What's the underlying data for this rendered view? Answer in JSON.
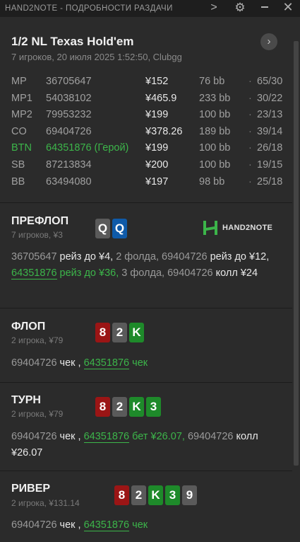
{
  "window": {
    "title": "HAND2NOTE - ПОДРОБНОСТИ РАЗДАЧИ",
    "chevron_glyph": ">",
    "gear_glyph": "⚙",
    "close_glyph": "✕"
  },
  "hand": {
    "title": "1/2 NL Texas Hold'em",
    "subtitle": "7 игроков, 20 июля 2025 1:52:50, Clubgg",
    "next_glyph": "›"
  },
  "players": [
    {
      "pos": "MP",
      "id": "36705647",
      "money": "¥152",
      "bb": "76 bb",
      "dot": "·",
      "stat": "65/30",
      "hero": false
    },
    {
      "pos": "MP1",
      "id": "54038102",
      "money": "¥465.9",
      "bb": "233 bb",
      "dot": "·",
      "stat": "30/22",
      "hero": false
    },
    {
      "pos": "MP2",
      "id": "79953232",
      "money": "¥199",
      "bb": "100 bb",
      "dot": "·",
      "stat": "23/13",
      "hero": false
    },
    {
      "pos": "CO",
      "id": "69404726",
      "money": "¥378.26",
      "bb": "189 bb",
      "dot": "·",
      "stat": "39/14",
      "hero": false
    },
    {
      "pos": "BTN",
      "id": "64351876 (Герой)",
      "money": "¥199",
      "bb": "100 bb",
      "dot": "·",
      "stat": "26/18",
      "hero": true
    },
    {
      "pos": "SB",
      "id": "87213834",
      "money": "¥200",
      "bb": "100 bb",
      "dot": "·",
      "stat": "19/15",
      "hero": false
    },
    {
      "pos": "BB",
      "id": "63494080",
      "money": "¥197",
      "bb": "98 bb",
      "dot": "·",
      "stat": "25/18",
      "hero": false
    }
  ],
  "logo_text": "HAND2NOTE",
  "colors": {
    "hero": "#3cb54a",
    "hearts": "#9b1515",
    "spades": "#5a5a5a",
    "clubs": "#1e8a2a",
    "diamonds": "#0f5aa8"
  },
  "streets": {
    "preflop": {
      "name": "ПРЕФЛОП",
      "sub": "7 игроков, ¥3",
      "cards": [
        {
          "rank": "Q",
          "suit": "spades"
        },
        {
          "rank": "Q",
          "suit": "diamonds"
        }
      ],
      "a1": "36705647 ",
      "a2": "рейз до ¥4,",
      "a3": " 2 фолда, 69404726 ",
      "a4": "рейз до ¥12,",
      "a5": " ",
      "a6": "64351876",
      "a7": " рейз до ¥36,",
      "a8": " 3 фолда, 69404726 ",
      "a9": "колл ¥24"
    },
    "flop": {
      "name": "ФЛОП",
      "sub": "2 игрока, ¥79",
      "cards": [
        {
          "rank": "8",
          "suit": "hearts"
        },
        {
          "rank": "2",
          "suit": "spades"
        },
        {
          "rank": "K",
          "suit": "clubs"
        }
      ],
      "a1": "69404726 ",
      "a2": "чек",
      ", ": "",
      "a3": " , ",
      "a4": "64351876",
      "a5": " чек"
    },
    "turn": {
      "name": "ТУРН",
      "sub": "2 игрока, ¥79",
      "cards": [
        {
          "rank": "8",
          "suit": "hearts"
        },
        {
          "rank": "2",
          "suit": "spades"
        },
        {
          "rank": "K",
          "suit": "clubs"
        },
        {
          "rank": "3",
          "suit": "clubs"
        }
      ],
      "a1": "69404726 ",
      "a2": "чек",
      "a3": " , ",
      "a4": "64351876",
      "a5": " бет ¥26.07,",
      "a6": " 69404726 ",
      "a7": "колл ¥26.07"
    },
    "river": {
      "name": "РИВЕР",
      "sub": "2 игрока, ¥131.14",
      "cards": [
        {
          "rank": "8",
          "suit": "hearts"
        },
        {
          "rank": "2",
          "suit": "spades"
        },
        {
          "rank": "K",
          "suit": "clubs"
        },
        {
          "rank": "3",
          "suit": "clubs"
        },
        {
          "rank": "9",
          "suit": "spades"
        }
      ],
      "a1": "69404726 ",
      "a2": "чек",
      "a3": " , ",
      "a4": "64351876",
      "a5": " чек"
    }
  }
}
